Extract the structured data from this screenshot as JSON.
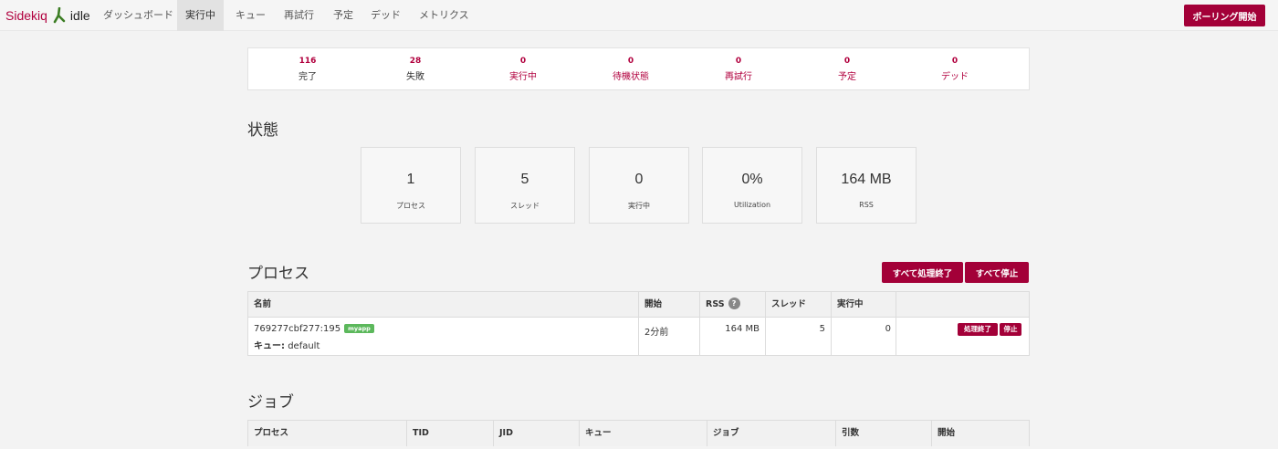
{
  "navbar": {
    "brand": "Sidekiq",
    "status": "idle",
    "items": [
      {
        "label": "ダッシュボード",
        "active": false
      },
      {
        "label": "実行中",
        "active": true
      },
      {
        "label": "キュー",
        "active": false
      },
      {
        "label": "再試行",
        "active": false
      },
      {
        "label": "予定",
        "active": false
      },
      {
        "label": "デッド",
        "active": false
      },
      {
        "label": "メトリクス",
        "active": false
      }
    ],
    "poll_button": "ポーリング開始"
  },
  "summary": [
    {
      "value": "116",
      "label": "完了"
    },
    {
      "value": "28",
      "label": "失敗"
    },
    {
      "value": "0",
      "label": "実行中"
    },
    {
      "value": "0",
      "label": "待機状態"
    },
    {
      "value": "0",
      "label": "再試行"
    },
    {
      "value": "0",
      "label": "予定"
    },
    {
      "value": "0",
      "label": "デッド"
    }
  ],
  "status_section": {
    "title": "状態",
    "stats": [
      {
        "value": "1",
        "label": "プロセス"
      },
      {
        "value": "5",
        "label": "スレッド"
      },
      {
        "value": "0",
        "label": "実行中"
      },
      {
        "value": "0%",
        "label": "Utilization"
      },
      {
        "value": "164 MB",
        "label": "RSS"
      }
    ]
  },
  "processes": {
    "title": "プロセス",
    "quiet_all": "すべて処理終了",
    "stop_all": "すべて停止",
    "headers": {
      "name": "名前",
      "started": "開始",
      "rss": "RSS",
      "help": "?",
      "threads": "スレッド",
      "busy": "実行中"
    },
    "rows": [
      {
        "name": "769277cbf277:195",
        "tag": "myapp",
        "queue_label": "キュー:",
        "queue": "default",
        "started": "2分前",
        "rss": "164 MB",
        "threads": "5",
        "busy": "0",
        "quiet": "処理終了",
        "stop": "停止"
      }
    ]
  },
  "jobs": {
    "title": "ジョブ",
    "headers": [
      "プロセス",
      "TID",
      "JID",
      "キュー",
      "ジョブ",
      "引数",
      "開始"
    ]
  },
  "colors": {
    "accent": "#a30038",
    "tag_green": "#5cb85c"
  }
}
